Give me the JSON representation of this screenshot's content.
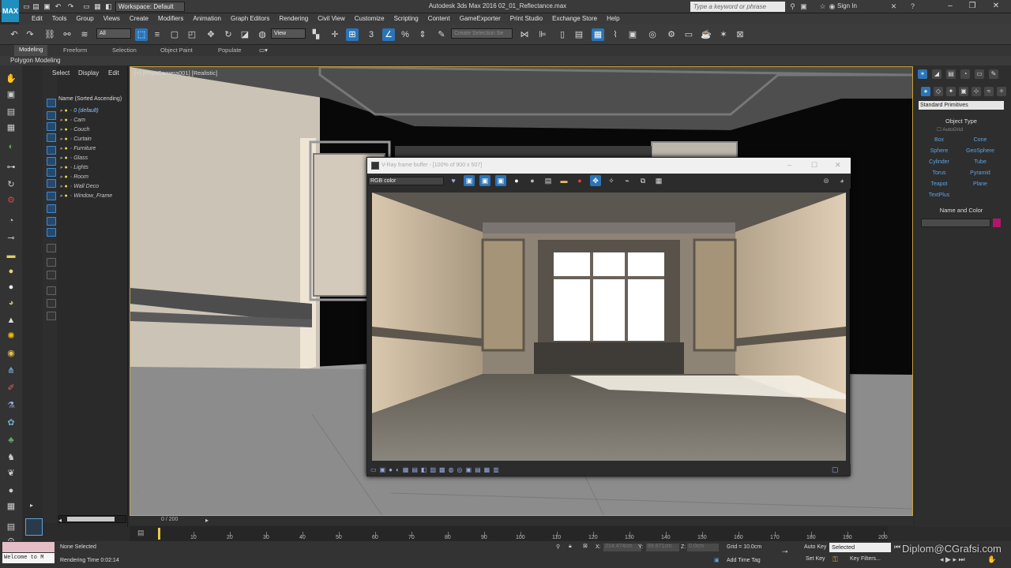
{
  "window": {
    "logo": "MAX",
    "workspace": "Workspace: Default",
    "title": "Autodesk 3ds Max 2016    02_01_Reflectance.max",
    "search_placeholder": "Type a keyword or phrase",
    "signin": "Sign In"
  },
  "menu": [
    "Edit",
    "Tools",
    "Group",
    "Views",
    "Create",
    "Modifiers",
    "Animation",
    "Graph Editors",
    "Rendering",
    "Civil View",
    "Customize",
    "Scripting",
    "Content",
    "GameExporter",
    "Print Studio",
    "Exchange Store",
    "Help"
  ],
  "toolbar": {
    "filter": "All",
    "refcoord": "View",
    "selection_set": "Create Selection Se"
  },
  "ribbon": {
    "tabs": [
      "Modeling",
      "Freeform",
      "Selection",
      "Object Paint",
      "Populate"
    ],
    "subtitle": "Polygon Modeling"
  },
  "explorer": {
    "tabs": [
      "Select",
      "Display",
      "Edit"
    ],
    "header": "Name (Sorted Ascending)",
    "layers": [
      "0 (default)",
      "Cam",
      "Couch",
      "Curtain",
      "Furniture",
      "Glass",
      "Lights",
      "Room",
      "Wall Deco",
      "Window_Frame"
    ]
  },
  "viewport": {
    "label": "[+] [PhysCamera001] [Realistic]"
  },
  "vfb": {
    "title": "V-Ray frame buffer - [100% of 900 x 507]",
    "channel": "RGB color"
  },
  "command_panel": {
    "category": "Standard Primitives",
    "object_type_header": "Object Type",
    "autogrid": "AutoGrid",
    "primitives": [
      "Box",
      "Cone",
      "Sphere",
      "GeoSphere",
      "Cylinder",
      "Tube",
      "Torus",
      "Pyramid",
      "Teapot",
      "Plane",
      "TextPlus"
    ],
    "name_color_header": "Name and Color",
    "swatch_color": "#b0166b"
  },
  "timeline": {
    "frame_display": "0 / 200",
    "ticks": [
      "10",
      "20",
      "30",
      "40",
      "50",
      "60",
      "70",
      "80",
      "90",
      "100",
      "110",
      "120",
      "130",
      "140",
      "150",
      "160",
      "170",
      "180",
      "190",
      "200"
    ]
  },
  "status": {
    "maxscript": "Welcome to M",
    "selection": "None Selected",
    "render_time": "Rendering Time  0:02:14",
    "x_label": "X:",
    "x_value": "214.474cm",
    "y_label": "Y:",
    "y_value": "89.871cm",
    "z_label": "Z:",
    "z_value": "0.0cm",
    "grid": "Grid = 10.0cm",
    "add_time_tag": "Add Time Tag",
    "auto_key": "Auto Key",
    "set_key": "Set Key",
    "key_mode": "Selected",
    "key_filters": "Key Filters...",
    "watermark": "Diplom@CGrafsi.com"
  }
}
